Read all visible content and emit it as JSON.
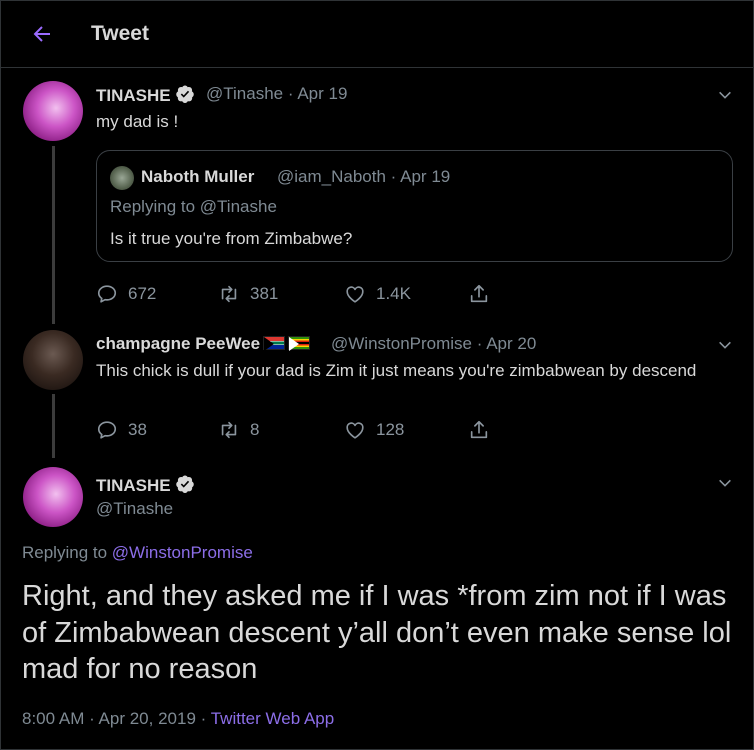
{
  "header": {
    "title": "Tweet"
  },
  "tweet1": {
    "name": "TINASHE",
    "handle": "@Tinashe",
    "sep": "·",
    "date": "Apr 19",
    "text": "my dad is !",
    "quote": {
      "name": "Naboth Muller",
      "handle": "@iam_Naboth",
      "sep": "·",
      "date": "Apr 19",
      "replying_prefix": "Replying to",
      "replying_to": "@Tinashe",
      "text": "Is it true you're from Zimbabwe?"
    },
    "replies": "672",
    "retweets": "381",
    "likes": "1.4K"
  },
  "tweet2": {
    "name": "champagne PeeWee",
    "handle": "@WinstonPromise",
    "sep": "·",
    "date": "Apr 20",
    "text": "This chick is dull if your dad is Zim it just means you're zimbabwean by descend",
    "replies": "38",
    "retweets": "8",
    "likes": "128"
  },
  "main": {
    "name": "TINASHE",
    "handle": "@Tinashe",
    "replying_prefix": "Replying to",
    "replying_to": "@WinstonPromise",
    "text": "Right, and they asked me if I was *from zim not if I was of Zimbabwean descent y’all don’t even make sense lol mad for no reason",
    "time": "8:00 AM · Apr 20, 2019",
    "sep": "·",
    "source": "Twitter Web App"
  },
  "colors": {
    "accent": "#8c6ee8",
    "background": "#000000",
    "muted": "#7f8a93"
  },
  "icons": [
    "back-arrow-icon",
    "verified-icon",
    "chevron-down-icon",
    "reply-icon",
    "retweet-icon",
    "like-icon",
    "share-icon"
  ]
}
